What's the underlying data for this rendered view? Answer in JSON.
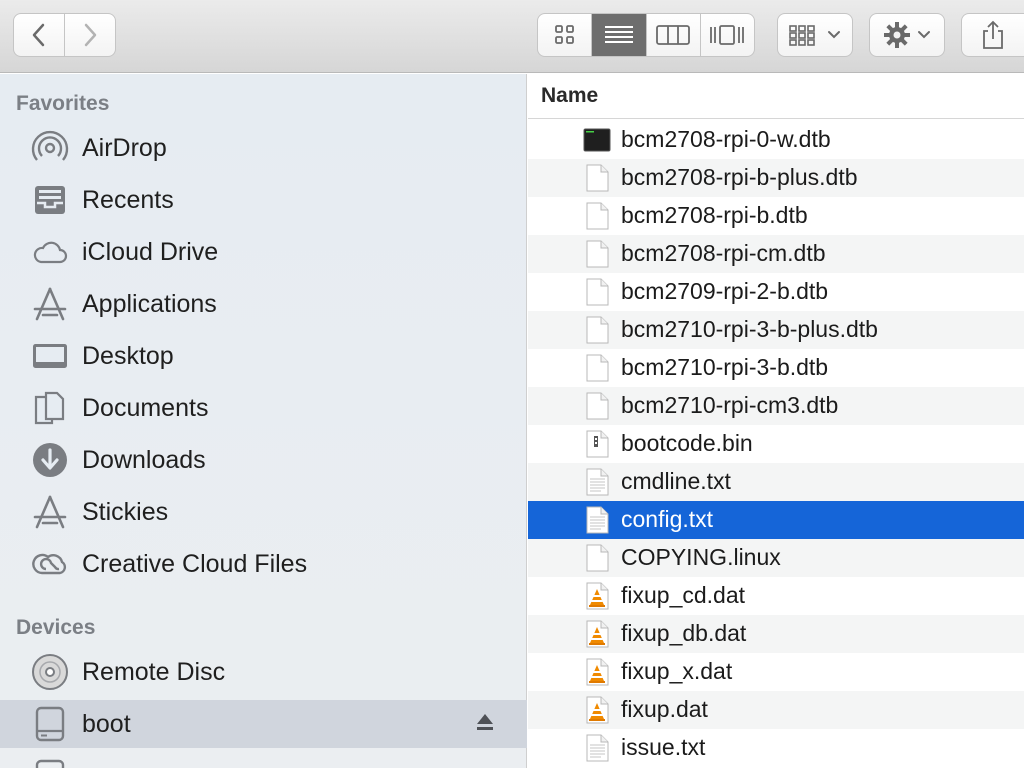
{
  "toolbar": {
    "nav": [
      {
        "name": "back",
        "icon": "chevron-left-icon"
      },
      {
        "name": "forward",
        "icon": "chevron-right-icon"
      }
    ],
    "views": [
      {
        "name": "icon-view",
        "icon": "grid-icon",
        "active": false
      },
      {
        "name": "list-view",
        "icon": "list-icon",
        "active": true
      },
      {
        "name": "column-view",
        "icon": "columns-icon",
        "active": false
      },
      {
        "name": "gallery-view",
        "icon": "coverflow-icon",
        "active": false
      }
    ],
    "arrange_icon": "arrange-grid-icon",
    "action_icon": "gear-icon",
    "share_icon": "share-icon"
  },
  "sidebar": {
    "sections": [
      {
        "title": "Favorites",
        "items": [
          {
            "label": "AirDrop",
            "icon": "airdrop-icon"
          },
          {
            "label": "Recents",
            "icon": "recents-icon"
          },
          {
            "label": "iCloud Drive",
            "icon": "cloud-icon"
          },
          {
            "label": "Applications",
            "icon": "applications-icon"
          },
          {
            "label": "Desktop",
            "icon": "desktop-icon"
          },
          {
            "label": "Documents",
            "icon": "documents-icon"
          },
          {
            "label": "Downloads",
            "icon": "downloads-icon"
          },
          {
            "label": "Stickies",
            "icon": "applications-icon"
          },
          {
            "label": "Creative Cloud Files",
            "icon": "creative-cloud-icon"
          }
        ]
      },
      {
        "title": "Devices",
        "items": [
          {
            "label": "Remote Disc",
            "icon": "disc-icon"
          },
          {
            "label": "boot",
            "icon": "drive-icon",
            "selected": true,
            "eject": true
          }
        ]
      }
    ]
  },
  "list": {
    "column_name": "Name",
    "files": [
      {
        "name": "bcm2708-rpi-0-w.dtb",
        "icon": "terminal-file-icon"
      },
      {
        "name": "bcm2708-rpi-b-plus.dtb",
        "icon": "blank-file-icon"
      },
      {
        "name": "bcm2708-rpi-b.dtb",
        "icon": "blank-file-icon"
      },
      {
        "name": "bcm2708-rpi-cm.dtb",
        "icon": "blank-file-icon"
      },
      {
        "name": "bcm2709-rpi-2-b.dtb",
        "icon": "blank-file-icon"
      },
      {
        "name": "bcm2710-rpi-3-b-plus.dtb",
        "icon": "blank-file-icon"
      },
      {
        "name": "bcm2710-rpi-3-b.dtb",
        "icon": "blank-file-icon"
      },
      {
        "name": "bcm2710-rpi-cm3.dtb",
        "icon": "blank-file-icon"
      },
      {
        "name": "bootcode.bin",
        "icon": "binary-file-icon"
      },
      {
        "name": "cmdline.txt",
        "icon": "text-file-icon"
      },
      {
        "name": "config.txt",
        "icon": "text-file-icon",
        "selected": true
      },
      {
        "name": "COPYING.linux",
        "icon": "blank-file-icon"
      },
      {
        "name": "fixup_cd.dat",
        "icon": "vlc-file-icon"
      },
      {
        "name": "fixup_db.dat",
        "icon": "vlc-file-icon"
      },
      {
        "name": "fixup_x.dat",
        "icon": "vlc-file-icon"
      },
      {
        "name": "fixup.dat",
        "icon": "vlc-file-icon"
      },
      {
        "name": "issue.txt",
        "icon": "text-file-icon"
      }
    ]
  },
  "colors": {
    "selection": "#1565d8",
    "sidebar_selection": "#d0d5dd",
    "vlc_orange": "#f08a00"
  }
}
